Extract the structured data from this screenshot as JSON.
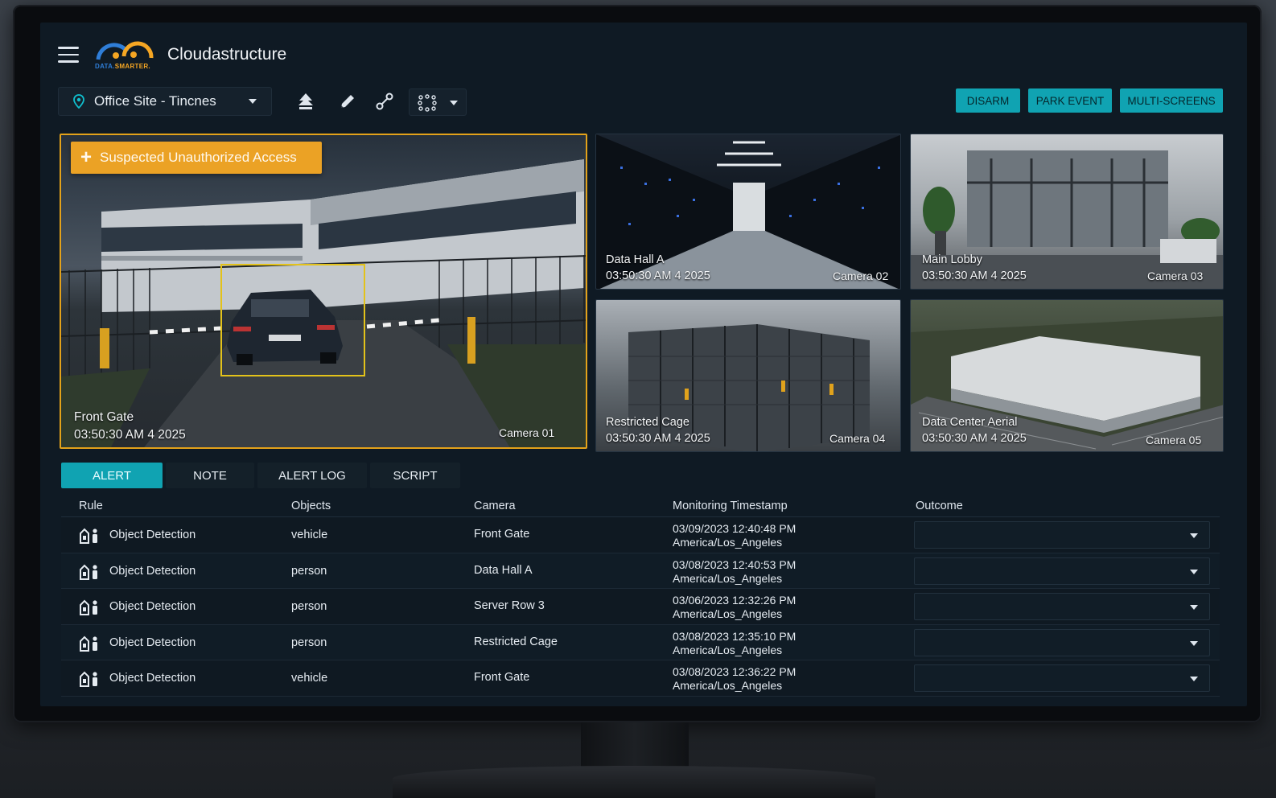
{
  "app": {
    "title": "Cloudastructure",
    "logo_text_a": "DATA.",
    "logo_text_b": "SMARTER."
  },
  "toolbar": {
    "site": "Office Site - Tincnes",
    "buttons": [
      "DISARM",
      "PARK EVENT",
      "MULTI-SCREENS"
    ]
  },
  "colors": {
    "accent": "#10a3b2",
    "alert": "#eba225",
    "detection_box": "#e3c21a",
    "background": "#0f1a24"
  },
  "main_camera": {
    "alert": "Suspected Unauthorized Access",
    "name": "Front Gate",
    "time": "03:50:30 AM  4 2025",
    "id": "Camera 01"
  },
  "cameras": [
    {
      "name": "Data Hall A",
      "time": "03:50:30 AM  4 2025",
      "id": "Camera 02"
    },
    {
      "name": "Main Lobby",
      "time": "03:50:30 AM  4 2025",
      "id": "Camera 03"
    },
    {
      "name": "Restricted Cage",
      "time": "03:50:30 AM  4 2025",
      "id": "Camera 04"
    },
    {
      "name": "Data Center Aerial",
      "time": "03:50:30 AM  4 2025",
      "id": "Camera 05"
    }
  ],
  "tabs": [
    "ALERT",
    "NOTE",
    "ALERT LOG",
    "SCRIPT"
  ],
  "table": {
    "headers": [
      "Rule",
      "Objects",
      "Camera",
      "Monitoring Timestamp",
      "Outcome"
    ],
    "rows": [
      {
        "rule": "Object Detection",
        "objects": "vehicle",
        "camera": "Front Gate",
        "ts": "03/09/2023 12:40:48 PM",
        "tz": "America/Los_Angeles"
      },
      {
        "rule": "Object Detection",
        "objects": "person",
        "camera": "Data Hall A",
        "ts": "03/08/2023 12:40:53 PM",
        "tz": "America/Los_Angeles"
      },
      {
        "rule": "Object Detection",
        "objects": "person",
        "camera": "Server Row 3",
        "ts": "03/06/2023 12:32:26 PM",
        "tz": "America/Los_Angeles"
      },
      {
        "rule": "Object Detection",
        "objects": "person",
        "camera": "Restricted Cage",
        "ts": "03/08/2023 12:35:10 PM",
        "tz": "America/Los_Angeles"
      },
      {
        "rule": "Object Detection",
        "objects": "vehicle",
        "camera": "Front Gate",
        "ts": "03/08/2023 12:36:22 PM",
        "tz": "America/Los_Angeles"
      }
    ]
  }
}
